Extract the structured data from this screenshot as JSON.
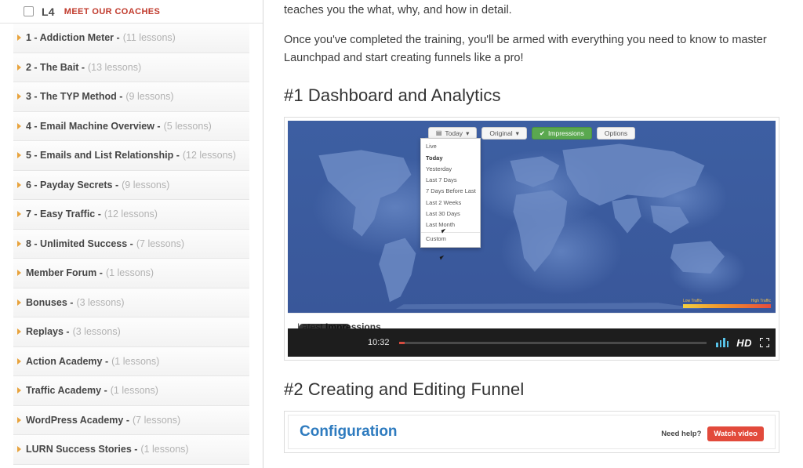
{
  "sidebar": {
    "header": {
      "level": "L4",
      "coaches_link": "MEET OUR COACHES"
    },
    "items": [
      {
        "title": "1 - Addiction Meter -",
        "count": "(11 lessons)"
      },
      {
        "title": "2 - The Bait -",
        "count": "(13 lessons)"
      },
      {
        "title": "3 - The TYP Method -",
        "count": "(9 lessons)"
      },
      {
        "title": "4 - Email Machine Overview -",
        "count": "(5 lessons)"
      },
      {
        "title": "5 - Emails and List Relationship -",
        "count": "(12 lessons)"
      },
      {
        "title": "6 - Payday Secrets -",
        "count": "(9 lessons)"
      },
      {
        "title": "7 - Easy Traffic -",
        "count": "(12 lessons)"
      },
      {
        "title": "8 - Unlimited Success -",
        "count": "(7 lessons)"
      },
      {
        "title": "Member Forum -",
        "count": "(1 lessons)"
      },
      {
        "title": "Bonuses -",
        "count": "(3 lessons)"
      },
      {
        "title": "Replays -",
        "count": "(3 lessons)"
      },
      {
        "title": "Action Academy -",
        "count": "(1 lessons)"
      },
      {
        "title": "Traffic Academy -",
        "count": "(1 lessons)"
      },
      {
        "title": "WordPress Academy -",
        "count": "(7 lessons)"
      },
      {
        "title": "LURN Success Stories -",
        "count": "(1 lessons)"
      }
    ]
  },
  "main": {
    "paragraph_top": "teaches you the what, why, and how in detail.",
    "paragraph_second": "Once you've completed the training, you'll be armed with everything you need to know to master Launchpad and start creating funnels like a pro!",
    "section1_heading": "#1 Dashboard and Analytics",
    "section2_heading": "#2 Creating and Editing Funnel",
    "video1": {
      "toolbar": {
        "date_button": "Today",
        "original_button": "Original",
        "impressions_button": "Impressions",
        "options_button": "Options",
        "calendar_icon": "calendar-icon",
        "check_icon": "check-icon",
        "caret_icon": "caret-down-icon"
      },
      "dropdown": {
        "options": [
          "Live",
          "Today",
          "Yesterday",
          "Last 7 Days",
          "7 Days Before Last",
          "Last 2 Weeks",
          "Last 30 Days",
          "Last Month",
          "Custom"
        ],
        "selected": "Today"
      },
      "legend": {
        "low": "Low Traffic",
        "high": "High Traffic"
      },
      "latest_label": "Latest",
      "latest_value": "Impressions",
      "player": {
        "time": "10:32",
        "quality": "HD",
        "play_icon": "play-icon",
        "volume_icon": "volume-bars-icon",
        "fullscreen_icon": "fullscreen-icon"
      }
    },
    "video2": {
      "title": "Configuration",
      "need_help": "Need help?",
      "watch_video": "Watch video"
    }
  },
  "colors": {
    "accent_red": "#c0392b",
    "link_blue": "#2e7bbf",
    "green_button": "#5aa84f",
    "map_blue": "#3b5c9e",
    "watch_button": "#e24a3b"
  }
}
